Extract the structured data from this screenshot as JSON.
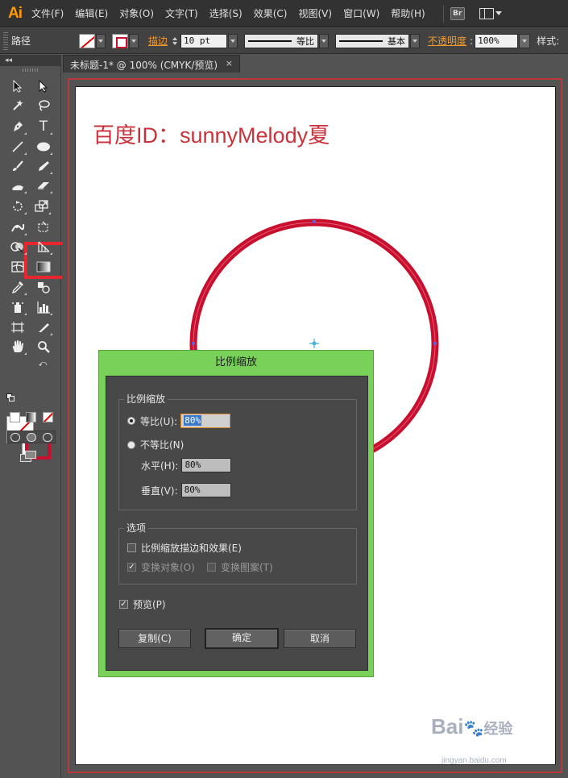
{
  "menubar": {
    "logo": "Ai",
    "items": [
      "文件(F)",
      "编辑(E)",
      "对象(O)",
      "文字(T)",
      "选择(S)",
      "效果(C)",
      "视图(V)",
      "窗口(W)",
      "帮助(H)"
    ],
    "br_label": "Br"
  },
  "controlbar": {
    "path_label": "路径",
    "stroke_label": "描边",
    "stroke_weight": "10 pt",
    "profile_label": "等比",
    "brush_label": "基本",
    "opacity_label": "不透明度",
    "opacity_value": "100%",
    "style_label": "样式:"
  },
  "document": {
    "tab_title": "未标题-1* @ 100% (CMYK/预览)",
    "tab_close": "×",
    "canvas_text": "百度ID：sunnyMelody夏"
  },
  "colors": {
    "accent_red": "#c8102e",
    "highlight_red": "#e8262d",
    "dialog_green": "#7ad15a",
    "menu_orange": "#ff9a00"
  },
  "dialog": {
    "title": "比例缩放",
    "scale_group_label": "比例缩放",
    "uniform_label": "等比(U):",
    "uniform_value": "80%",
    "nonuniform_label": "不等比(N)",
    "horizontal_label": "水平(H):",
    "horizontal_value": "80%",
    "vertical_label": "垂直(V):",
    "vertical_value": "80%",
    "options_group_label": "选项",
    "scale_strokes_label": "比例缩放描边和效果(E)",
    "transform_objects_label": "变换对象(O)",
    "transform_patterns_label": "变换图案(T)",
    "preview_label": "预览(P)",
    "copy_button": "复制(C)",
    "ok_button": "确定",
    "cancel_button": "取消"
  },
  "watermark": {
    "brand": "Bai",
    "brand_cn": "经验",
    "url": "jingyan.baidu.com"
  }
}
